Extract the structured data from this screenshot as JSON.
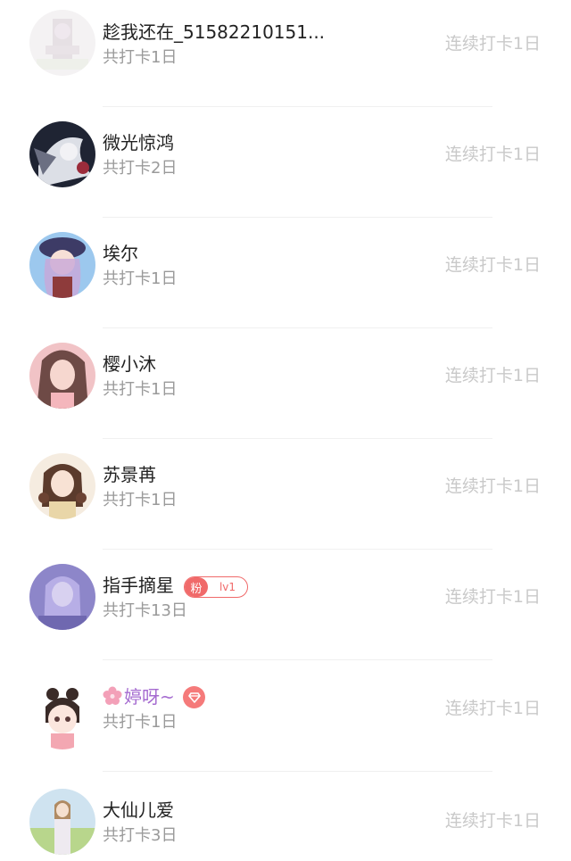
{
  "users": [
    {
      "name": "趁我还在_51582210151...",
      "total": "共打卡1日",
      "streak": "连续打卡1日"
    },
    {
      "name": "微光惊鸿",
      "total": "共打卡2日",
      "streak": "连续打卡1日"
    },
    {
      "name": "埃尔",
      "total": "共打卡1日",
      "streak": "连续打卡1日"
    },
    {
      "name": "樱小沐",
      "total": "共打卡1日",
      "streak": "连续打卡1日"
    },
    {
      "name": "苏景苒",
      "total": "共打卡1日",
      "streak": "连续打卡1日"
    },
    {
      "name": "指手摘星",
      "total": "共打卡13日",
      "streak": "连续打卡1日",
      "badge": {
        "label": "粉",
        "level": "lv1"
      }
    },
    {
      "name": "婷呀~",
      "total": "共打卡1日",
      "streak": "连续打卡1日",
      "badge_icon": "gem-icon",
      "name_icon": "sakura-icon"
    },
    {
      "name": "大仙儿爱",
      "total": "共打卡3日",
      "streak": "连续打卡1日"
    }
  ],
  "colors": {
    "name": "#222222",
    "sub": "#9a9a9a",
    "streak": "#c9c9c9",
    "fan_badge": "#f06a6a",
    "vip_name": "#a56bd0"
  }
}
